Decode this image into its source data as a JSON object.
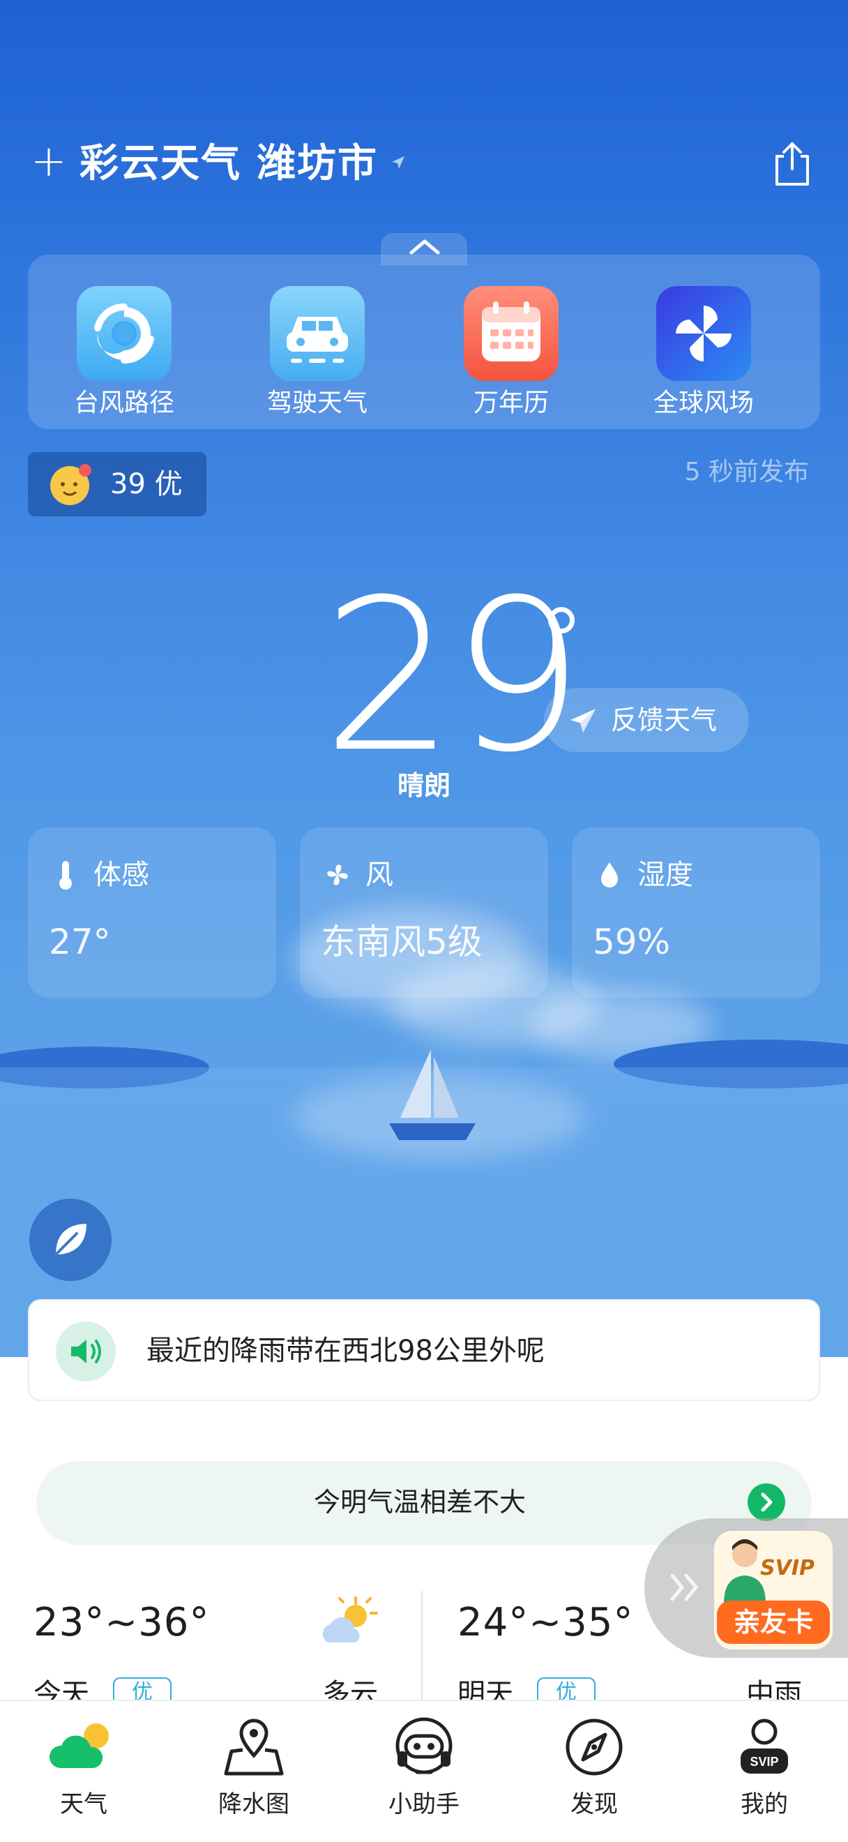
{
  "header": {
    "add_symbol": "+",
    "app_name": "彩云天气",
    "city": "潍坊市"
  },
  "quick_panel": {
    "items": [
      {
        "label": "台风路径",
        "icon": "typhoon-icon"
      },
      {
        "label": "驾驶天气",
        "icon": "car-icon"
      },
      {
        "label": "万年历",
        "icon": "calendar-icon"
      },
      {
        "label": "全球风场",
        "icon": "pinwheel-icon"
      }
    ]
  },
  "aqi": {
    "text": "39 优"
  },
  "publish_time": "5 秒前发布",
  "current": {
    "temperature": "29",
    "condition": "晴朗",
    "feedback_label": "反馈天气"
  },
  "cards": [
    {
      "title": "体感",
      "value": "27°",
      "icon": "thermometer-icon"
    },
    {
      "title": "风",
      "value": "东南风5级",
      "icon": "fan-icon"
    },
    {
      "title": "湿度",
      "value": "59%",
      "icon": "droplet-icon"
    }
  ],
  "notice": {
    "text": "最近的降雨带在西北98公里外呢"
  },
  "compare": {
    "text": "今明气温相差不大"
  },
  "forecast": [
    {
      "range": "23°~36°",
      "day": "今天",
      "aqi": "优",
      "condition": "多云"
    },
    {
      "range": "24°~35°",
      "day": "明天",
      "aqi": "优",
      "condition": "中雨"
    }
  ],
  "promo": {
    "badge": "SVIP",
    "label": "亲友卡"
  },
  "tabs": [
    {
      "label": "天气",
      "icon": "weather-icon"
    },
    {
      "label": "降水图",
      "icon": "map-pin-icon"
    },
    {
      "label": "小助手",
      "icon": "assistant-icon"
    },
    {
      "label": "发现",
      "icon": "compass-icon"
    },
    {
      "label": "我的",
      "icon": "profile-icon"
    }
  ],
  "colors": {
    "sky_top": "#1e61d4",
    "sky_bottom": "#62a6ea",
    "accent_green": "#12b868",
    "badge_blue": "#33aeda"
  }
}
